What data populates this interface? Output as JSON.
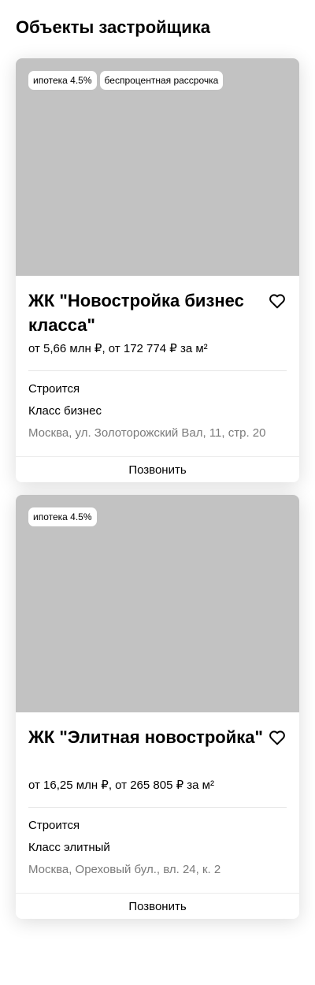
{
  "page": {
    "title": "Объекты застройщика"
  },
  "colors": {
    "photo_placeholder": "#c2c2c2",
    "secondary_text": "#7a7a7a"
  },
  "cards": [
    {
      "badges": [
        "ипотека 4.5%",
        "беспроцентная рассрочка"
      ],
      "title": "ЖК \"Новостройка бизнес класса\"",
      "price": "от 5,66 млн ₽, от 172 774 ₽ за м²",
      "status": "Строится",
      "class": "Класс бизнес",
      "address": "Москва, ул. Золоторожский Вал, 11, стр. 20",
      "favorite_icon": "heart-outline-icon",
      "call_label": "Позвонить"
    },
    {
      "badges": [
        "ипотека 4.5%"
      ],
      "title": "ЖК \"Элитная новостройка\"",
      "price": "от 16,25 млн ₽, от 265 805 ₽ за м²",
      "status": "Строится",
      "class": "Класс элитный",
      "address": "Москва, Ореховый бул., вл. 24, к. 2",
      "favorite_icon": "heart-outline-icon",
      "call_label": "Позвонить"
    }
  ]
}
